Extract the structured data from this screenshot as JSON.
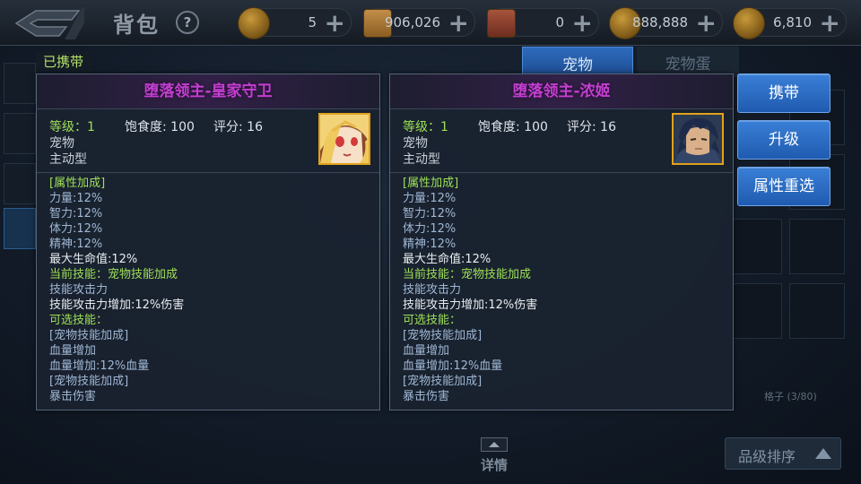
{
  "header": {
    "title": "背包",
    "help_label": "?",
    "currencies": [
      {
        "icon": "coin-icon",
        "value": "5"
      },
      {
        "icon": "scroll-icon",
        "value": "906,026"
      },
      {
        "icon": "lock-scroll-icon",
        "value": "0"
      },
      {
        "icon": "gold-coin-icon",
        "value": "888,888"
      },
      {
        "icon": "gem-coin-icon",
        "value": "6,810"
      }
    ],
    "plus_label": "+"
  },
  "tabs": {
    "pet": "宠物",
    "pet_egg": "宠物蛋"
  },
  "carried_label": "已携带",
  "cards": [
    {
      "name": "堕落领主-皇家守卫",
      "level_text": "等级：1",
      "satiety_text": "饱食度: 100",
      "score_text": "评分: 16",
      "type_text": "宠物",
      "role_text": "主动型",
      "portrait": "blonde-girl-portrait",
      "lines": [
        {
          "text": "[属性加成]",
          "color": "green"
        },
        {
          "text": "力量:12%",
          "color": "blue"
        },
        {
          "text": "智力:12%",
          "color": "blue"
        },
        {
          "text": "体力:12%",
          "color": "blue"
        },
        {
          "text": "精神:12%",
          "color": "blue"
        },
        {
          "text": "最大生命值:12%",
          "color": "white"
        },
        {
          "text": "当前技能：宠物技能加成",
          "color": "green"
        },
        {
          "text": "技能攻击力",
          "color": "blue"
        },
        {
          "text": "技能攻击力增加:12%伤害",
          "color": "white"
        },
        {
          "text": "可选技能：",
          "color": "green"
        },
        {
          "text": "[宠物技能加成]",
          "color": "blue"
        },
        {
          "text": "血量增加",
          "color": "blue"
        },
        {
          "text": "血量增加:12%血量",
          "color": "blue"
        },
        {
          "text": "[宠物技能加成]",
          "color": "blue"
        },
        {
          "text": "暴击伤害",
          "color": "blue"
        }
      ]
    },
    {
      "name": "堕落领主-浓姬",
      "level_text": "等级：1",
      "satiety_text": "饱食度: 100",
      "score_text": "评分: 16",
      "type_text": "宠物",
      "role_text": "主动型",
      "portrait": "dark-haired-warrior-portrait",
      "lines": [
        {
          "text": "[属性加成]",
          "color": "green"
        },
        {
          "text": "力量:12%",
          "color": "blue"
        },
        {
          "text": "智力:12%",
          "color": "blue"
        },
        {
          "text": "体力:12%",
          "color": "blue"
        },
        {
          "text": "精神:12%",
          "color": "blue"
        },
        {
          "text": "最大生命值:12%",
          "color": "white"
        },
        {
          "text": "当前技能：宠物技能加成",
          "color": "green"
        },
        {
          "text": "技能攻击力",
          "color": "blue"
        },
        {
          "text": "技能攻击力增加:12%伤害",
          "color": "white"
        },
        {
          "text": "可选技能：",
          "color": "green"
        },
        {
          "text": "[宠物技能加成]",
          "color": "blue"
        },
        {
          "text": "血量增加",
          "color": "blue"
        },
        {
          "text": "血量增加:12%血量",
          "color": "blue"
        },
        {
          "text": "[宠物技能加成]",
          "color": "blue"
        },
        {
          "text": "暴击伤害",
          "color": "blue"
        }
      ]
    }
  ],
  "actions": {
    "carry": "携带",
    "upgrade": "升级",
    "reroll": "属性重选"
  },
  "inventory": {
    "capacity_text": "格子 (3/80)"
  },
  "sort_label": "品级排序",
  "detail_label": "详情",
  "colors": {
    "title_purple": "#c23fd0",
    "green": "#9ee057",
    "button_blue": "#2c6dc4",
    "portrait_border": "#e2a21c"
  }
}
